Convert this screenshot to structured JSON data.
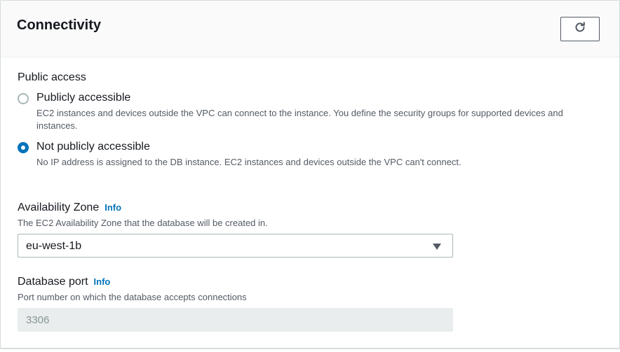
{
  "panel": {
    "title": "Connectivity",
    "refresh_icon": "refresh-icon"
  },
  "public_access": {
    "label": "Public access",
    "options": [
      {
        "label": "Publicly accessible",
        "description": "EC2 instances and devices outside the VPC can connect to the instance. You define the security groups for supported devices and instances.",
        "selected": false
      },
      {
        "label": "Not publicly accessible",
        "description": "No IP address is assigned to the DB instance. EC2 instances and devices outside the VPC can't connect.",
        "selected": true
      }
    ]
  },
  "availability_zone": {
    "label": "Availability Zone",
    "info": "Info",
    "description": "The EC2 Availability Zone that the database will be created in.",
    "value": "eu-west-1b"
  },
  "database_port": {
    "label": "Database port",
    "info": "Info",
    "description": "Port number on which the database accepts connections",
    "value": "3306"
  },
  "colors": {
    "accent": "#0073bb",
    "text": "#16191f",
    "secondary_text": "#545b64",
    "disabled_bg": "#eaeded"
  }
}
